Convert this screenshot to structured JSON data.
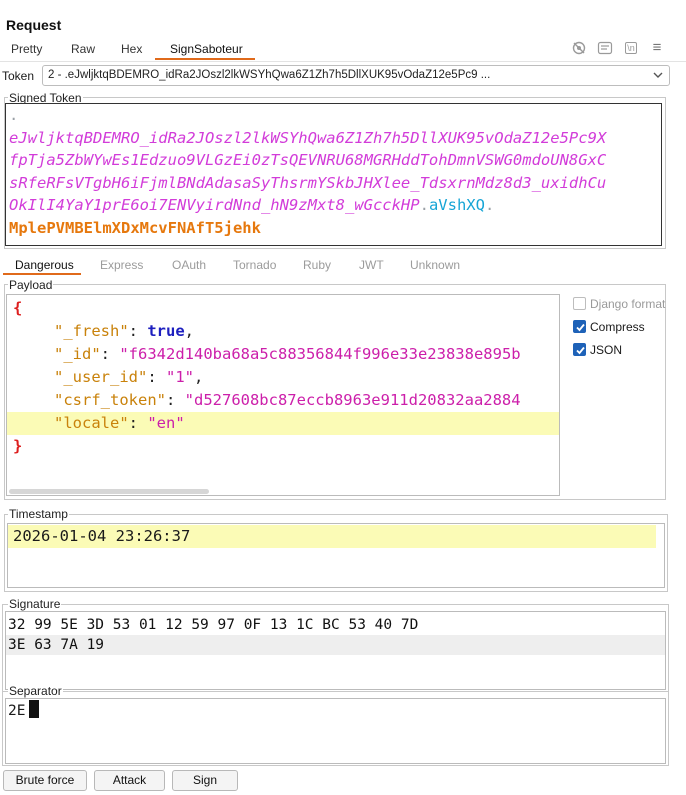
{
  "header": {
    "title": "Request"
  },
  "tabs": [
    {
      "label": "Pretty"
    },
    {
      "label": "Raw"
    },
    {
      "label": "Hex"
    },
    {
      "label": "SignSaboteur"
    }
  ],
  "toolbar": {
    "icons": [
      "eye-off-icon",
      "wrap-icon",
      "newline-icon",
      "menu-icon"
    ],
    "newline_glyph": "\\n",
    "menu_glyph": "≡"
  },
  "token": {
    "label": "Token",
    "selected": "2 - .eJwljktqBDEMRO_idRa2JOszl2lkWSYhQwa6Z1Zh7h5DllXUK95vOdaZ12e5Pc9 ..."
  },
  "signed_token": {
    "label": "Signed Token",
    "lines": [
      {
        "dot": "."
      },
      {
        "head": "eJwljktqBDEMRO_idRa2JOszl2lkWSYhQwa6Z1Zh7h5DllXUK95vOdaZ12e5Pc9X"
      },
      {
        "head": "fpTja5ZbWYwEs1Edzuo9VLGzEi0zTsQEVNRU68MGRHddTohDmnVSWG0mdoUN8GxC"
      },
      {
        "head": "sRfeRFsVTgbH6iFjmlBNdAdasaSyThsrmYSkbJHXlee_TdsxrnMdz8d3_uxidhCu"
      },
      {
        "head": "OkIlI4YaY1prE6oi7ENVyirdNnd_hN9zMxt8_wGcckHP",
        "dot1": ".",
        "ts": "aVshXQ",
        "dot2": "."
      },
      {
        "sig": "MplePVMBElmXDxMcvFNAfT5jehk"
      }
    ]
  },
  "tabs2": [
    {
      "label": "Dangerous"
    },
    {
      "label": "Express"
    },
    {
      "label": "OAuth"
    },
    {
      "label": "Tornado"
    },
    {
      "label": "Ruby"
    },
    {
      "label": "JWT"
    },
    {
      "label": "Unknown"
    }
  ],
  "payload": {
    "label": "Payload",
    "open_brace": "{",
    "close_brace": "}",
    "fields": [
      {
        "key": "\"_fresh\"",
        "value": "true",
        "type": "bool",
        "comma": ","
      },
      {
        "key": "\"_id\"",
        "value": "\"f6342d140ba68a5c88356844f996e33e23838e895b",
        "type": "str",
        "comma": ""
      },
      {
        "key": "\"_user_id\"",
        "value": "\"1\"",
        "type": "str",
        "comma": ","
      },
      {
        "key": "\"csrf_token\"",
        "value": "\"d527608bc87eccb8963e911d20832aa2884",
        "type": "str",
        "comma": ""
      },
      {
        "key": "\"locale\"",
        "value": "\"en\"",
        "type": "str",
        "comma": ""
      }
    ]
  },
  "options": [
    {
      "label": "Django format",
      "checked": false
    },
    {
      "label": "Compress",
      "checked": true
    },
    {
      "label": "JSON",
      "checked": true
    }
  ],
  "timestamp": {
    "label": "Timestamp",
    "value": "2026-01-04 23:26:37"
  },
  "signature": {
    "label": "Signature",
    "lines": [
      "32 99 5E 3D 53 01 12 59 97 0F 13 1C BC 53 40 7D",
      "3E 63 7A 19"
    ]
  },
  "separator": {
    "label": "Separator",
    "value": "2E"
  },
  "buttons": {
    "brute_force": "Brute force",
    "attack": "Attack",
    "sign": "Sign"
  },
  "colors": {
    "accent": "#e06a1b",
    "token_header": "#d23cd9",
    "token_timestamp": "#17a5d6",
    "token_signature": "#e6780d",
    "highlight": "#fbfbb6",
    "checkbox": "#1e62b8"
  }
}
